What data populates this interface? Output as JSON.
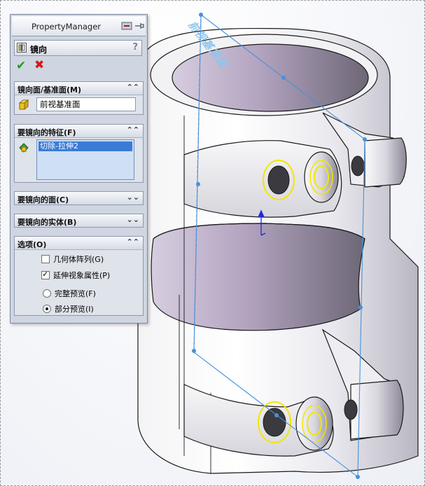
{
  "property_manager": {
    "title": "PropertyManager",
    "feature": {
      "name": "镜向",
      "help": "?"
    },
    "sections": [
      {
        "label": "镜向面/基准面(M)",
        "state": "expanded",
        "value": "前视基准面"
      },
      {
        "label": "要镜向的特征(F)",
        "state": "expanded",
        "items": [
          "切除-拉伸2"
        ]
      },
      {
        "label": "要镜向的面(C)",
        "state": "collapsed"
      },
      {
        "label": "要镜向的实体(B)",
        "state": "collapsed"
      },
      {
        "label": "选项(O)",
        "state": "expanded",
        "options": [
          {
            "label": "几何体阵列(G)",
            "kind": "checkbox",
            "checked": false
          },
          {
            "label": "延伸视象属性(P)",
            "kind": "checkbox",
            "checked": true
          },
          {
            "label": "完整预览(F)",
            "kind": "radio",
            "checked": false
          },
          {
            "label": "部分预览(I)",
            "kind": "radio",
            "checked": true
          }
        ]
      }
    ]
  },
  "viewport": {
    "plane_label": "前视基准面"
  },
  "colors": {
    "plane": "#4a90d9",
    "highlight_edge": "#f2e600",
    "ok": "#1aa01a",
    "cancel": "#d21a1a"
  }
}
